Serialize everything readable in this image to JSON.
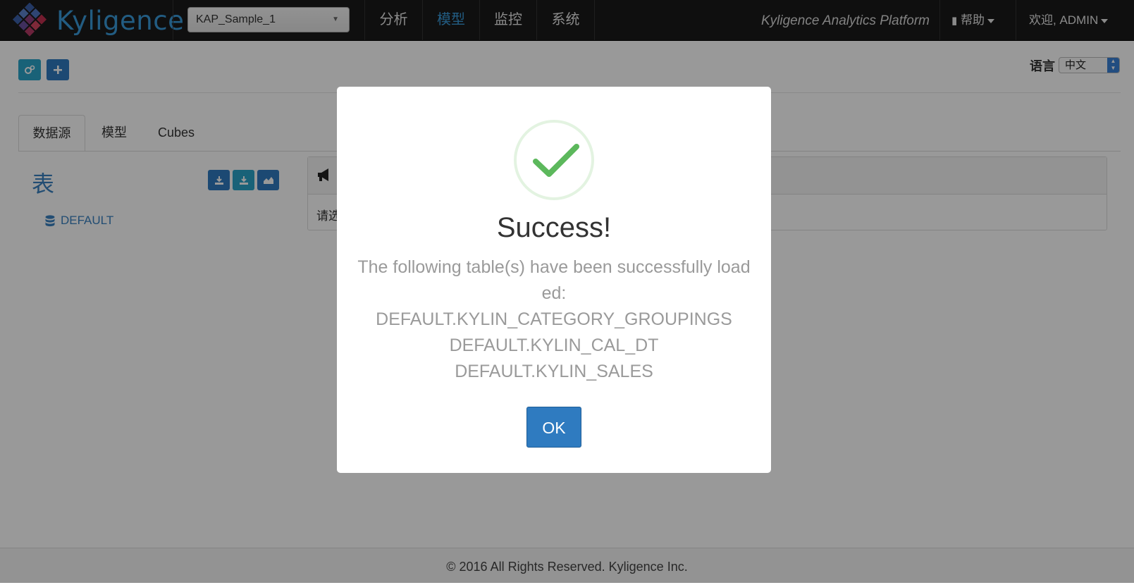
{
  "navbar": {
    "brand": "Kyligence",
    "project": "KAP_Sample_1",
    "menu": [
      "分析",
      "模型",
      "监控",
      "系统"
    ],
    "active_menu": "模型",
    "platform": "Kyligence Analytics Platform",
    "help": "帮助",
    "user": "欢迎, ADMIN"
  },
  "toolbar": {
    "language_label": "语言",
    "language_value": "中文"
  },
  "tabs": [
    "数据源",
    "模型",
    "Cubes"
  ],
  "sidebar": {
    "title": "表",
    "databases": [
      "DEFAULT"
    ]
  },
  "panel": {
    "body_text": "请选"
  },
  "footer": "© 2016 All Rights Reserved. Kyligence Inc.",
  "modal": {
    "title": "Success!",
    "message": "The following table(s) have been successfully loaded:",
    "tables": [
      "DEFAULT.KYLIN_CATEGORY_GROUPINGS",
      "DEFAULT.KYLIN_CAL_DT",
      "DEFAULT.KYLIN_SALES"
    ],
    "ok_label": "OK",
    "icon": "success-check-icon",
    "success_color": "#5cb85c"
  },
  "colors": {
    "brand": "#3a9ad9",
    "primary": "#2f7bc0",
    "info": "#2aa3c9"
  }
}
